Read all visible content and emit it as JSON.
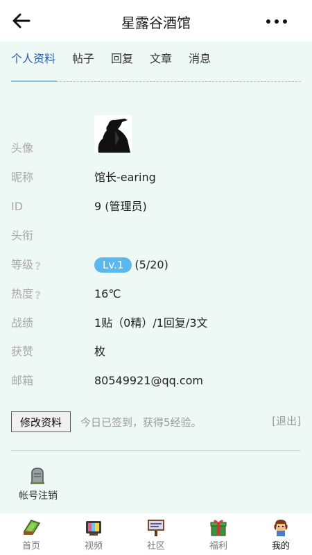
{
  "header": {
    "title": "星露谷酒馆"
  },
  "tabs": [
    {
      "label": "个人资料",
      "active": true
    },
    {
      "label": "帖子"
    },
    {
      "label": "回复"
    },
    {
      "label": "文章"
    },
    {
      "label": "消息"
    }
  ],
  "profile": {
    "avatar_label": "头像",
    "nickname_label": "昵称",
    "nickname": "馆长-earing",
    "id_label": "ID",
    "id_value": "9 (管理员)",
    "title_label": "头衔",
    "title_value": "",
    "level_label": "等级",
    "level_badge": "Lv.1",
    "level_progress": "(5/20)",
    "heat_label": "热度",
    "heat_value": "16℃",
    "record_label": "战绩",
    "record_value": "1贴（0精）/1回复/3文",
    "likes_label": "获赞",
    "likes_value": "枚",
    "email_label": "邮箱",
    "email_value": "80549921@qq.com",
    "help_glyph": "?"
  },
  "actions": {
    "edit_label": "修改资料",
    "signin_text": "今日已签到，获得5经验。",
    "logout_label": "[退出]",
    "cancel_account_label": "帐号注销"
  },
  "bottom_nav": [
    {
      "label": "首页",
      "icon": "home-icon"
    },
    {
      "label": "视频",
      "icon": "tv-icon"
    },
    {
      "label": "社区",
      "icon": "community-sign-icon"
    },
    {
      "label": "福利",
      "icon": "gift-icon"
    },
    {
      "label": "我的",
      "icon": "profile-character-icon",
      "active": true
    }
  ],
  "colors": {
    "accent": "#2c5fa8",
    "badge": "#5bb8ee",
    "content_bg": "#eef8f5"
  }
}
